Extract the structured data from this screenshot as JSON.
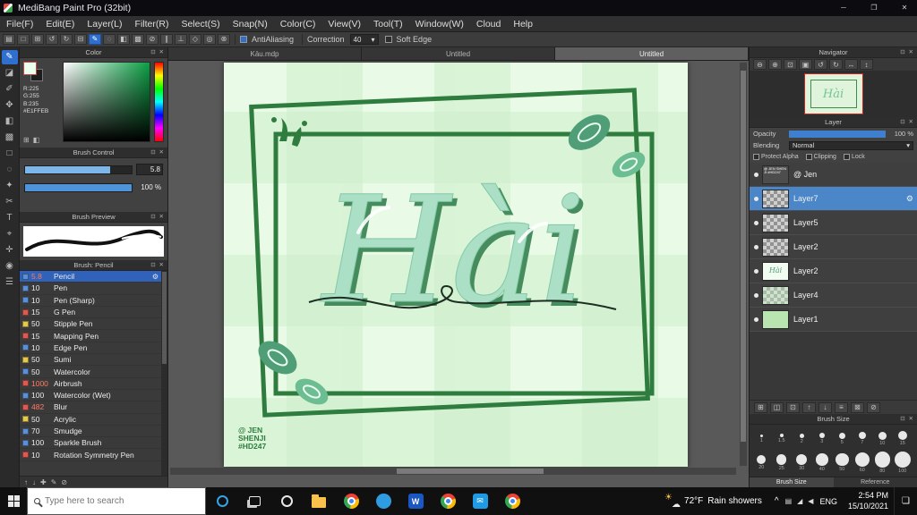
{
  "window": {
    "title": "MediBang Paint Pro (32bit)",
    "controls": {
      "minimize": "─",
      "maximize": "❐",
      "close": "✕"
    }
  },
  "menu": {
    "items": [
      "File(F)",
      "Edit(E)",
      "Layer(L)",
      "Filter(R)",
      "Select(S)",
      "Snap(N)",
      "Color(C)",
      "View(V)",
      "Tool(T)",
      "Window(W)",
      "Cloud",
      "Help"
    ]
  },
  "toolbar": {
    "icons": [
      {
        "name": "new-canvas-icon",
        "glyph": "▤"
      },
      {
        "name": "open-file-icon",
        "glyph": "□"
      },
      {
        "name": "save-icon",
        "glyph": "⊞"
      },
      {
        "name": "undo-icon",
        "glyph": "↺"
      },
      {
        "name": "redo-icon",
        "glyph": "↻"
      },
      {
        "name": "transform-icon",
        "glyph": "⊟"
      },
      {
        "name": "freehand-brush-icon",
        "glyph": "✎",
        "active": true
      },
      {
        "name": "line-tool-icon",
        "glyph": "◌"
      },
      {
        "name": "polyline-tool-icon",
        "glyph": "◧"
      },
      {
        "name": "grid-tool-icon",
        "glyph": "▩"
      },
      {
        "name": "snap-off-icon",
        "glyph": "⊘"
      },
      {
        "name": "snap-parallel-icon",
        "glyph": "∥"
      },
      {
        "name": "snap-cross-icon",
        "glyph": "⊥"
      },
      {
        "name": "snap-vanishing-icon",
        "glyph": "◇"
      },
      {
        "name": "snap-circle-icon",
        "glyph": "◎"
      },
      {
        "name": "snap-curve-icon",
        "glyph": "⊗"
      }
    ],
    "anti_aliasing_label": "AntiAliasing",
    "correction_label": "Correction",
    "correction_value": "40",
    "soft_edge_label": "Soft Edge"
  },
  "tools": {
    "items": [
      {
        "name": "brush-tool",
        "glyph": "✎",
        "active": true
      },
      {
        "name": "eraser-tool",
        "glyph": "◪"
      },
      {
        "name": "pen-tool",
        "glyph": "✐"
      },
      {
        "name": "move-tool",
        "glyph": "✥"
      },
      {
        "name": "fill-tool",
        "glyph": "◧"
      },
      {
        "name": "gradient-tool",
        "glyph": "▩"
      },
      {
        "name": "select-tool",
        "glyph": "□"
      },
      {
        "name": "lasso-tool",
        "glyph": "◌"
      },
      {
        "name": "magic-wand-tool",
        "glyph": "✦"
      },
      {
        "name": "select-pen-tool",
        "glyph": "✂"
      },
      {
        "name": "text-tool",
        "glyph": "T"
      },
      {
        "name": "operation-tool",
        "glyph": "⌖"
      },
      {
        "name": "divide-tool",
        "glyph": "✛"
      },
      {
        "name": "eyedropper-tool",
        "glyph": "◉"
      },
      {
        "name": "pan-tool",
        "glyph": "☰"
      }
    ]
  },
  "color_panel": {
    "title": "Color",
    "r": "R:225",
    "g": "G:255",
    "b": "B:235",
    "hex": "#E1FFEB"
  },
  "brush_control": {
    "title": "Brush Control",
    "size_value": "5.8",
    "opacity_value": "100 %"
  },
  "brush_preview": {
    "title": "Brush Preview"
  },
  "brush_panel": {
    "title": "Brush: Pencil",
    "items": [
      {
        "size": "5.8",
        "name": "Pencil",
        "swatch": "#5b8fd6",
        "size_color": "#ff7b63",
        "selected": true
      },
      {
        "size": "10",
        "name": "Pen",
        "swatch": "#5b8fd6"
      },
      {
        "size": "10",
        "name": "Pen (Sharp)",
        "swatch": "#5b8fd6"
      },
      {
        "size": "15",
        "name": "G Pen",
        "swatch": "#d95b52"
      },
      {
        "size": "50",
        "name": "Stipple Pen",
        "swatch": "#e3c94e"
      },
      {
        "size": "15",
        "name": "Mapping Pen",
        "swatch": "#d95b52"
      },
      {
        "size": "10",
        "name": "Edge Pen",
        "swatch": "#5b8fd6"
      },
      {
        "size": "50",
        "name": "Sumi",
        "swatch": "#e3c94e"
      },
      {
        "size": "50",
        "name": "Watercolor",
        "swatch": "#5b8fd6"
      },
      {
        "size": "1000",
        "name": "Airbrush",
        "swatch": "#d95b52",
        "size_color": "#ff7b63"
      },
      {
        "size": "100",
        "name": "Watercolor (Wet)",
        "swatch": "#5b8fd6"
      },
      {
        "size": "482",
        "name": "Blur",
        "swatch": "#d95b52",
        "size_color": "#ff7b63"
      },
      {
        "size": "50",
        "name": "Acrylic",
        "swatch": "#e3c94e"
      },
      {
        "size": "70",
        "name": "Smudge",
        "swatch": "#5b8fd6"
      },
      {
        "size": "100",
        "name": "Sparkle Brush",
        "swatch": "#5b8fd6"
      },
      {
        "size": "10",
        "name": "Rotation Symmetry Pen",
        "swatch": "#d95b52"
      }
    ],
    "footer_icons": [
      {
        "name": "move-brush-up-icon",
        "glyph": "↑"
      },
      {
        "name": "move-brush-down-icon",
        "glyph": "↓"
      },
      {
        "name": "add-brush-icon",
        "glyph": "✚"
      },
      {
        "name": "edit-brush-icon",
        "glyph": "✎"
      },
      {
        "name": "delete-brush-icon",
        "glyph": "⊘"
      }
    ]
  },
  "canvas": {
    "tabs": [
      {
        "label": "Kāu.mdp"
      },
      {
        "label": "Untitled"
      },
      {
        "label": "Untitled",
        "active": true
      }
    ]
  },
  "artwork": {
    "title": "Hài",
    "signature": [
      "@ JEN",
      "SHENJI",
      "#HD247"
    ]
  },
  "navigator": {
    "title": "Navigator",
    "thumb_text": "Hài",
    "icons": [
      {
        "name": "zoom-out-icon",
        "glyph": "⊖"
      },
      {
        "name": "zoom-in-icon",
        "glyph": "⊕"
      },
      {
        "name": "fit-window-icon",
        "glyph": "⊡"
      },
      {
        "name": "actual-size-icon",
        "glyph": "▣"
      },
      {
        "name": "rotate-left-icon",
        "glyph": "↺"
      },
      {
        "name": "rotate-right-icon",
        "glyph": "↻"
      },
      {
        "name": "flip-horizontal-icon",
        "glyph": "↔"
      },
      {
        "name": "reset-view-icon",
        "glyph": "↕"
      }
    ]
  },
  "layer_panel": {
    "title": "Layer",
    "opacity_label": "Opacity",
    "opacity_value": "100 %",
    "blending_label": "Blending",
    "blending_value": "Normal",
    "checkboxes": [
      "Protect Alpha",
      "Clipping",
      "Lock"
    ],
    "layers": [
      {
        "name": "@ Jen",
        "thumb": "signature",
        "thumb_text": "@ JEN SHENJI #HD247"
      },
      {
        "name": "Layer7",
        "thumb": "checker",
        "selected": true
      },
      {
        "name": "Layer5",
        "thumb": "checker"
      },
      {
        "name": "Layer2",
        "thumb": "checker"
      },
      {
        "name": "Layer2",
        "thumb": "hai",
        "thumb_text": "Hài"
      },
      {
        "name": "Layer4",
        "thumb": "checker-green"
      },
      {
        "name": "Layer1",
        "thumb": "green"
      }
    ],
    "buttons": [
      {
        "name": "add-layer-button",
        "glyph": "⊞"
      },
      {
        "name": "add-folder-button",
        "glyph": "◫"
      },
      {
        "name": "duplicate-layer-button",
        "glyph": "⊡"
      },
      {
        "name": "move-layer-up-button",
        "glyph": "↑"
      },
      {
        "name": "move-layer-down-button",
        "glyph": "↓"
      },
      {
        "name": "merge-layer-button",
        "glyph": "≡"
      },
      {
        "name": "clear-layer-button",
        "glyph": "⊠"
      },
      {
        "name": "delete-layer-button",
        "glyph": "⊘"
      }
    ]
  },
  "brush_size_panel": {
    "title": "Brush Size",
    "rows": [
      [
        "1",
        "1.5",
        "2",
        "3",
        "5",
        "7",
        "10",
        "15"
      ],
      [
        "20",
        "25",
        "30",
        "40",
        "50",
        "60",
        "80",
        "100"
      ]
    ],
    "tabs": [
      {
        "label": "Brush Size",
        "active": true
      },
      {
        "label": "Reference"
      }
    ]
  },
  "taskbar": {
    "search_placeholder": "Type here to search",
    "apps": [
      {
        "name": "cortana-icon",
        "kind": "ring-blue"
      },
      {
        "name": "task-view-icon",
        "kind": "taskview"
      },
      {
        "name": "opera-icon",
        "kind": "ring"
      },
      {
        "name": "file-explorer-icon",
        "kind": "folder"
      },
      {
        "name": "chrome-icon",
        "kind": "chrome"
      },
      {
        "name": "skype-icon",
        "kind": "blue-circle"
      },
      {
        "name": "word-icon",
        "kind": "word",
        "label": "W"
      },
      {
        "name": "chrome-icon-2",
        "kind": "chrome"
      },
      {
        "name": "mail-icon",
        "kind": "mail",
        "label": "✉"
      },
      {
        "name": "chrome-icon-3",
        "kind": "chrome"
      }
    ],
    "weather": {
      "temp": "72°F",
      "condition": "Rain showers"
    },
    "tray": {
      "chevron": "^",
      "icons": [
        {
          "name": "tablet-pc-icon",
          "glyph": "▤"
        },
        {
          "name": "network-icon",
          "glyph": "◢"
        },
        {
          "name": "volume-icon",
          "glyph": "◀"
        }
      ],
      "lang": "ENG",
      "time": "2:54 PM",
      "date": "15/10/2021"
    }
  }
}
